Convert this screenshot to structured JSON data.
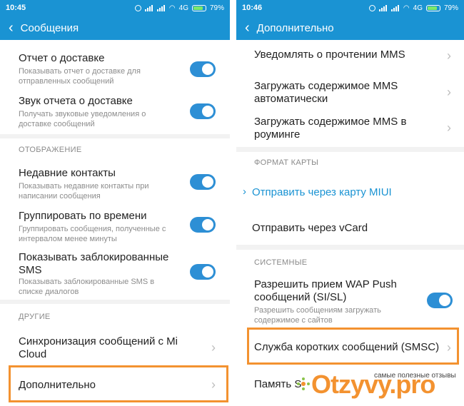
{
  "left": {
    "status": {
      "time": "10:45",
      "network": "4G",
      "battery": "79%"
    },
    "header": {
      "title": "Сообщения"
    },
    "items": [
      {
        "title": "Отчет о доставке",
        "subtitle": "Показывать отчет о доставке для отправленных сообщений",
        "toggle": true
      },
      {
        "title": "Звук отчета о доставке",
        "subtitle": "Получать звуковые уведомления о доставке сообщений",
        "toggle": true
      }
    ],
    "section_display": "ОТОБРАЖЕНИЕ",
    "display_items": [
      {
        "title": "Недавние контакты",
        "subtitle": "Показывать недавние контакты при написании сообщения",
        "toggle": true
      },
      {
        "title": "Группировать по времени",
        "subtitle": "Группировать сообщения, полученные с интервалом менее минуты",
        "toggle": true
      },
      {
        "title": "Показывать заблокированные SMS",
        "subtitle": "Показывать заблокированные SMS в списке диалогов",
        "toggle": true
      }
    ],
    "section_other": "ДРУГИЕ",
    "other_items": [
      {
        "title": "Синхронизация сообщений с Mi Cloud"
      },
      {
        "title": "Дополнительно"
      }
    ]
  },
  "right": {
    "status": {
      "time": "10:46",
      "network": "4G",
      "battery": "79%"
    },
    "header": {
      "title": "Дополнительно"
    },
    "items": [
      {
        "title": "Уведомлять о прочтении MMS"
      },
      {
        "title": "Загружать содержимое MMS автоматически"
      },
      {
        "title": "Загружать содержимое MMS в роуминге"
      }
    ],
    "section_card": "ФОРМАТ КАРТЫ",
    "card_items": [
      {
        "title": "Отправить через карту MIUI"
      },
      {
        "title": "Отправить через vCard"
      }
    ],
    "section_system": "СИСТЕМНЫЕ",
    "system_items": [
      {
        "title": "Разрешить прием WAP Push сообщений (SI/SL)",
        "subtitle": "Разрешить сообщениям загружать содержимое с сайтов",
        "toggle": true
      },
      {
        "title": "Служба коротких сообщений (SMSC)"
      },
      {
        "title": "Память S"
      }
    ]
  },
  "watermark": {
    "brand": "Otzyvy.pro",
    "tagline": "самые полезные отзывы"
  },
  "colors": {
    "accent": "#1a93d3",
    "toggle_on": "#2d8fd5",
    "highlight": "#f39230"
  }
}
